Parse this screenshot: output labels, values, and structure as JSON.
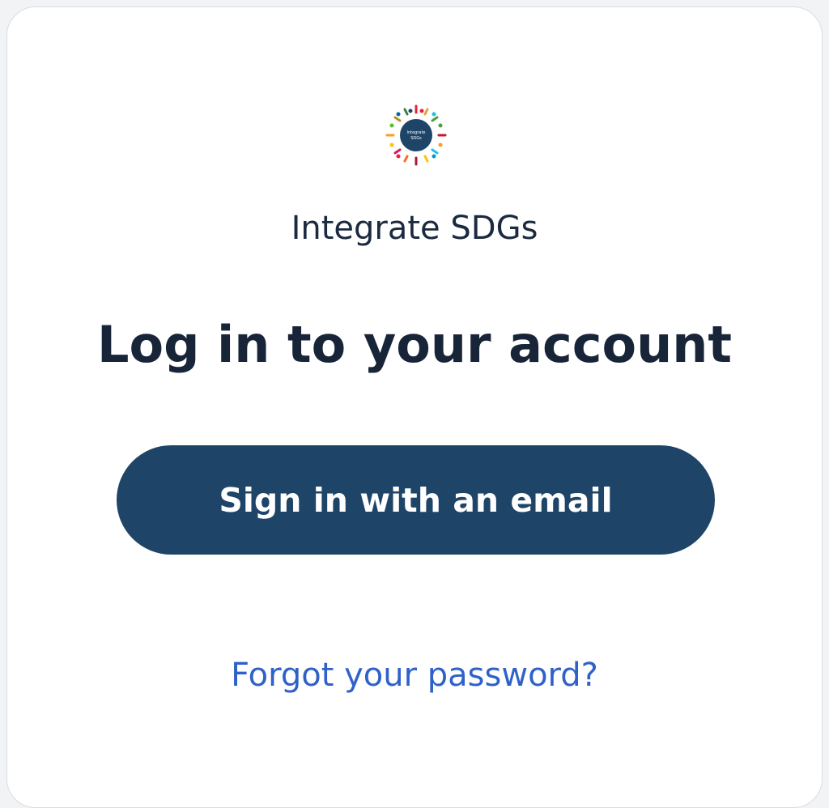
{
  "brand": {
    "name": "Integrate SDGs",
    "logo_text_line1": "Integrate",
    "logo_text_line2": "SDGs",
    "logo_icon": "sdg-wheel-icon"
  },
  "login": {
    "title": "Log in to your account",
    "sign_in_label": "Sign in with an email",
    "forgot_label": "Forgot your password?"
  },
  "colors": {
    "button_bg": "#1e4468",
    "link": "#2f62c9",
    "heading": "#182538",
    "logo_center": "#1e4468"
  }
}
